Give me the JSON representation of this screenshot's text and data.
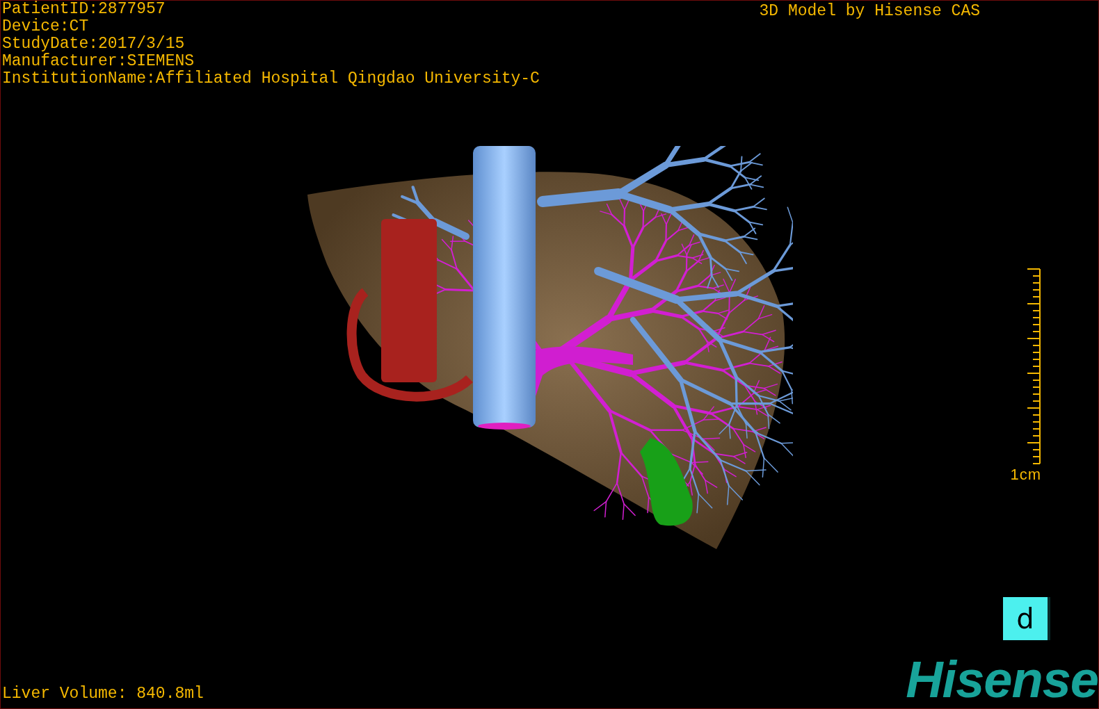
{
  "patient_info": [
    "PatientID:2877957",
    "Device:CT",
    "StudyDate:2017/3/15",
    "Manufacturer:SIEMENS",
    "InstitutionName:Affiliated Hospital Qingdao University-C"
  ],
  "title": "3D Model by Hisense CAS",
  "scale_bar": {
    "label": "1cm"
  },
  "orientation_cube": {
    "label": "d"
  },
  "liver_volume": "Liver Volume: 840.8ml",
  "logo": "Hisense"
}
